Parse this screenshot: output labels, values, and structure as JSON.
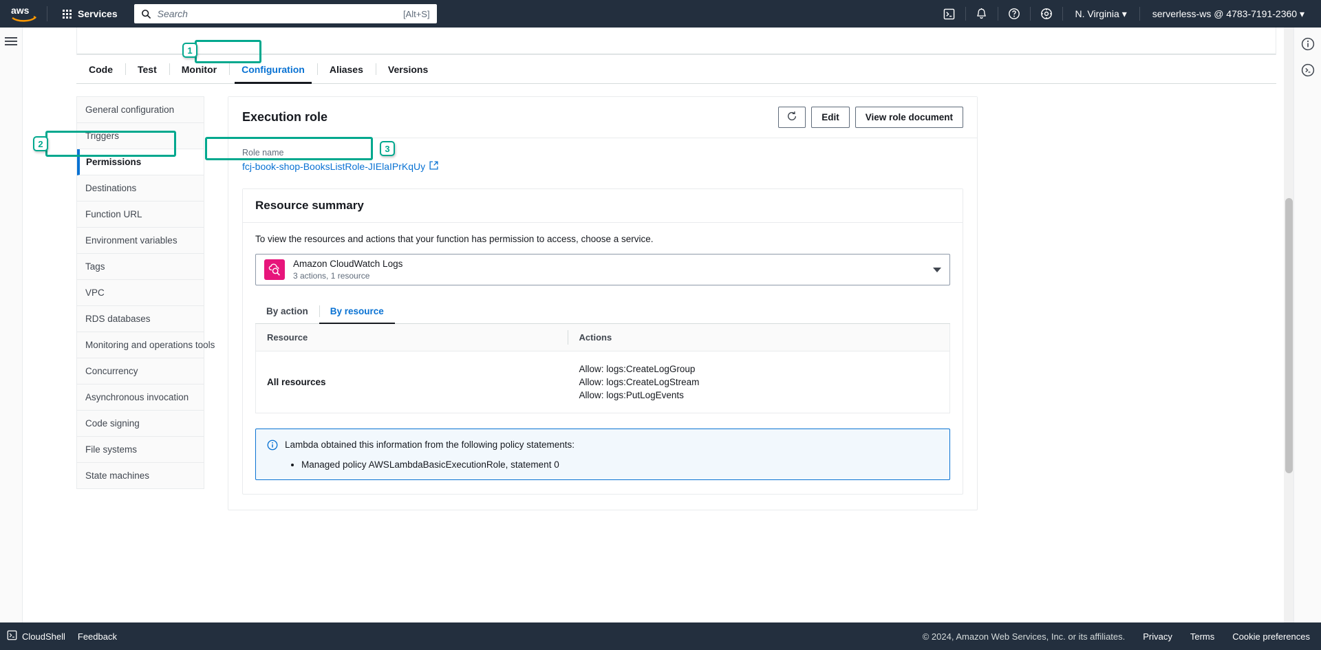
{
  "topnav": {
    "logo_alt": "aws",
    "services_label": "Services",
    "search_placeholder": "Search",
    "search_value": "",
    "search_shortcut": "[Alt+S]",
    "icons": [
      "cloudshell-icon",
      "notifications-icon",
      "help-icon",
      "settings-icon"
    ],
    "region": "N. Virginia",
    "account": "serverless-ws @ 4783-7191-2360"
  },
  "tabs": [
    {
      "label": "Code",
      "active": false
    },
    {
      "label": "Test",
      "active": false
    },
    {
      "label": "Monitor",
      "active": false
    },
    {
      "label": "Configuration",
      "active": true
    },
    {
      "label": "Aliases",
      "active": false
    },
    {
      "label": "Versions",
      "active": false
    }
  ],
  "sidebar": {
    "items": [
      {
        "label": "General configuration",
        "active": false
      },
      {
        "label": "Triggers",
        "active": false
      },
      {
        "label": "Permissions",
        "active": true
      },
      {
        "label": "Destinations",
        "active": false
      },
      {
        "label": "Function URL",
        "active": false
      },
      {
        "label": "Environment variables",
        "active": false
      },
      {
        "label": "Tags",
        "active": false
      },
      {
        "label": "VPC",
        "active": false
      },
      {
        "label": "RDS databases",
        "active": false
      },
      {
        "label": "Monitoring and operations tools",
        "active": false
      },
      {
        "label": "Concurrency",
        "active": false
      },
      {
        "label": "Asynchronous invocation",
        "active": false
      },
      {
        "label": "Code signing",
        "active": false
      },
      {
        "label": "File systems",
        "active": false
      },
      {
        "label": "State machines",
        "active": false
      }
    ]
  },
  "execution_role": {
    "title": "Execution role",
    "refresh_label": "refresh-icon",
    "edit_label": "Edit",
    "view_role_label": "View role document",
    "role_name_label": "Role name",
    "role_name_value": "fcj-book-shop-BooksListRole-JIElaIPrKqUy",
    "role_link_icon": "external-link-icon"
  },
  "resource_summary": {
    "title": "Resource summary",
    "description": "To view the resources and actions that your function has permission to access, choose a service.",
    "service": {
      "name": "Amazon CloudWatch Logs",
      "sub": "3 actions, 1 resource",
      "icon": "cloudwatch-logs-icon"
    },
    "inner_tabs": [
      {
        "label": "By action",
        "active": false
      },
      {
        "label": "By resource",
        "active": true
      }
    ],
    "table": {
      "columns": [
        "Resource",
        "Actions"
      ],
      "rows": [
        {
          "resource": "All resources",
          "actions": [
            "Allow: logs:CreateLogGroup",
            "Allow: logs:CreateLogStream",
            "Allow: logs:PutLogEvents"
          ]
        }
      ]
    },
    "alert": {
      "icon": "info-icon",
      "text": "Lambda obtained this information from the following policy statements:",
      "items": [
        "Managed policy AWSLambdaBasicExecutionRole, statement 0"
      ]
    }
  },
  "annotations": [
    {
      "number": "1",
      "target": "configuration-tab"
    },
    {
      "number": "2",
      "target": "permissions-sidebar-item"
    },
    {
      "number": "3",
      "target": "role-name-link"
    }
  ],
  "footer": {
    "cloudshell": "CloudShell",
    "feedback": "Feedback",
    "copyright": "© 2024, Amazon Web Services, Inc. or its affiliates.",
    "privacy": "Privacy",
    "terms": "Terms",
    "cookies": "Cookie preferences"
  },
  "colors": {
    "nav_bg": "#232f3e",
    "accent_link": "#0972d3",
    "annotation": "#00a88e",
    "cloudwatch_pink": "#e7157b",
    "alert_bg": "#f2f8fd"
  }
}
